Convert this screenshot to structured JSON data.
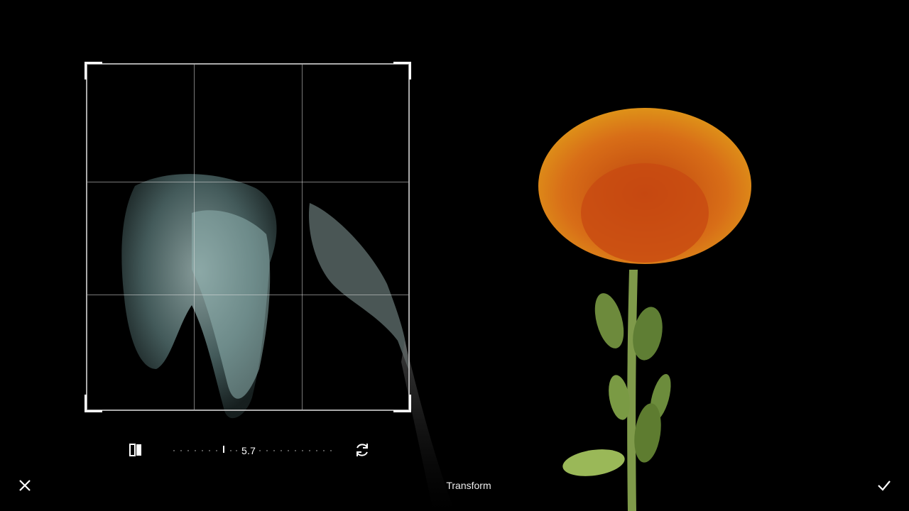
{
  "editor": {
    "mode_title": "Transform",
    "rotation_value": "5.7"
  },
  "icons": {
    "flip": "flip-horizontal-icon",
    "rotate": "rotate-icon",
    "cancel": "close-icon",
    "confirm": "check-icon"
  },
  "colors": {
    "background": "#000000",
    "frame": "#c8c8c8",
    "accent_flower": "#f08a1a"
  }
}
